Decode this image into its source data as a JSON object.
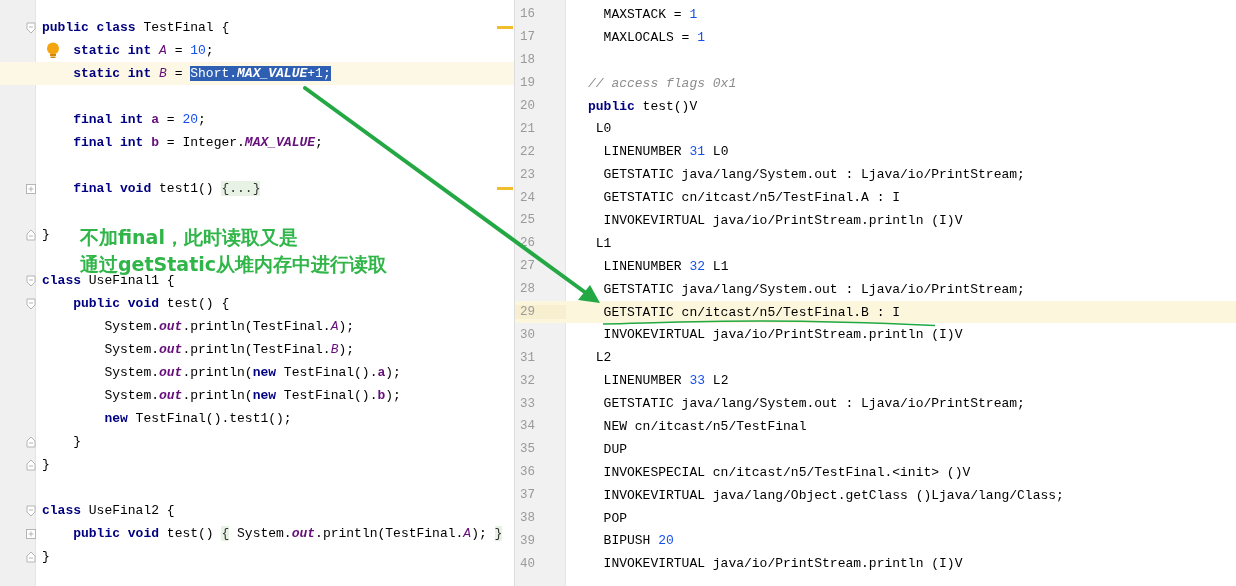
{
  "editor": {
    "lines": [
      {
        "kind": "fold-open",
        "current": false,
        "warning": true,
        "tokens": [
          {
            "text": "public class ",
            "kind": "kw"
          },
          {
            "text": "TestFinal {",
            "kind": "plain"
          }
        ],
        "children": [
          {
            "kind": "bulb",
            "current": false,
            "warning": false,
            "tokens": [
              {
                "text": "static int ",
                "kind": "kw"
              },
              {
                "text": "A",
                "kind": "static"
              },
              {
                "text": " = ",
                "kind": "plain"
              },
              {
                "text": "10",
                "kind": "num"
              },
              {
                "text": ";",
                "kind": "plain"
              }
            ]
          },
          {
            "kind": "plain",
            "current": true,
            "warning": false,
            "tokens": [
              {
                "text": "static int ",
                "kind": "kw"
              },
              {
                "text": "B",
                "kind": "static"
              },
              {
                "text": " = ",
                "kind": "plain"
              }
            ],
            "selection": [
              {
                "text": "Short.",
                "kind": "plain"
              },
              {
                "text": "MAX_VALUE",
                "kind": "const"
              },
              {
                "text": "+1;",
                "kind": "plain"
              }
            ]
          },
          {
            "kind": "blank",
            "current": false,
            "warning": false
          },
          {
            "kind": "plain",
            "current": false,
            "warning": false,
            "tokens": [
              {
                "text": "final int ",
                "kind": "kw"
              },
              {
                "text": "a",
                "kind": "field"
              },
              {
                "text": " = ",
                "kind": "plain"
              },
              {
                "text": "20",
                "kind": "num"
              },
              {
                "text": ";",
                "kind": "plain"
              }
            ]
          },
          {
            "kind": "plain",
            "current": false,
            "warning": false,
            "tokens": [
              {
                "text": "final int ",
                "kind": "kw"
              },
              {
                "text": "b",
                "kind": "field"
              },
              {
                "text": " = Integer.",
                "kind": "plain"
              },
              {
                "text": "MAX_VALUE",
                "kind": "const"
              },
              {
                "text": ";",
                "kind": "plain"
              }
            ]
          },
          {
            "kind": "blank",
            "current": false,
            "warning": false
          },
          {
            "kind": "fold-closed",
            "current": false,
            "warning": true,
            "tokens": [
              {
                "text": "final void ",
                "kind": "kw"
              },
              {
                "text": "test1() ",
                "kind": "plain"
              },
              {
                "text": "{...}",
                "kind": "folded"
              }
            ]
          },
          {
            "kind": "blank",
            "current": false,
            "warning": false
          }
        ]
      },
      {
        "kind": "fold-end",
        "current": false,
        "warning": false,
        "tokens": [
          {
            "text": "}",
            "kind": "plain"
          }
        ]
      },
      {
        "kind": "blank",
        "current": false,
        "warning": false
      },
      {
        "kind": "fold-open",
        "current": false,
        "warning": false,
        "tokens": [
          {
            "text": "class ",
            "kind": "kw"
          },
          {
            "text": "UseFinal1 {",
            "kind": "plain"
          }
        ],
        "children": [
          {
            "kind": "fold-open",
            "current": false,
            "warning": false,
            "tokens": [
              {
                "text": "public void ",
                "kind": "kw"
              },
              {
                "text": "test() {",
                "kind": "plain"
              }
            ],
            "children": [
              {
                "kind": "plain",
                "current": false,
                "warning": false,
                "tokens": [
                  {
                    "text": "System.",
                    "kind": "plain"
                  },
                  {
                    "text": "out",
                    "kind": "const"
                  },
                  {
                    "text": ".println(TestFinal.",
                    "kind": "plain"
                  },
                  {
                    "text": "A",
                    "kind": "static"
                  },
                  {
                    "text": ");",
                    "kind": "plain"
                  }
                ]
              },
              {
                "kind": "plain",
                "current": false,
                "warning": false,
                "tokens": [
                  {
                    "text": "System.",
                    "kind": "plain"
                  },
                  {
                    "text": "out",
                    "kind": "const"
                  },
                  {
                    "text": ".println(TestFinal.",
                    "kind": "plain"
                  },
                  {
                    "text": "B",
                    "kind": "static"
                  },
                  {
                    "text": ");",
                    "kind": "plain"
                  }
                ]
              },
              {
                "kind": "plain",
                "current": false,
                "warning": false,
                "tokens": [
                  {
                    "text": "System.",
                    "kind": "plain"
                  },
                  {
                    "text": "out",
                    "kind": "const"
                  },
                  {
                    "text": ".println(",
                    "kind": "plain"
                  },
                  {
                    "text": "new",
                    "kind": "kw"
                  },
                  {
                    "text": " TestFinal().",
                    "kind": "plain"
                  },
                  {
                    "text": "a",
                    "kind": "field"
                  },
                  {
                    "text": ");",
                    "kind": "plain"
                  }
                ]
              },
              {
                "kind": "plain",
                "current": false,
                "warning": false,
                "tokens": [
                  {
                    "text": "System.",
                    "kind": "plain"
                  },
                  {
                    "text": "out",
                    "kind": "const"
                  },
                  {
                    "text": ".println(",
                    "kind": "plain"
                  },
                  {
                    "text": "new",
                    "kind": "kw"
                  },
                  {
                    "text": " TestFinal().",
                    "kind": "plain"
                  },
                  {
                    "text": "b",
                    "kind": "field"
                  },
                  {
                    "text": ");",
                    "kind": "plain"
                  }
                ]
              },
              {
                "kind": "plain",
                "current": false,
                "warning": false,
                "tokens": [
                  {
                    "text": "new",
                    "kind": "kw"
                  },
                  {
                    "text": " TestFinal().test1();",
                    "kind": "plain"
                  }
                ]
              }
            ]
          },
          {
            "kind": "fold-end",
            "current": false,
            "warning": false,
            "tokens": [
              {
                "text": "}",
                "kind": "plain"
              }
            ]
          }
        ]
      },
      {
        "kind": "fold-end",
        "current": false,
        "warning": false,
        "tokens": [
          {
            "text": "}",
            "kind": "plain"
          }
        ]
      },
      {
        "kind": "blank",
        "current": false,
        "warning": false
      },
      {
        "kind": "fold-open",
        "current": false,
        "warning": false,
        "tokens": [
          {
            "text": "class ",
            "kind": "kw"
          },
          {
            "text": "UseFinal2 {",
            "kind": "plain"
          }
        ],
        "children": [
          {
            "kind": "fold-closed",
            "current": false,
            "warning": false,
            "tokens": [
              {
                "text": "public void ",
                "kind": "kw"
              },
              {
                "text": "test() ",
                "kind": "plain"
              },
              {
                "text": "{",
                "kind": "folded"
              },
              {
                "text": " System.",
                "kind": "plain"
              },
              {
                "text": "out",
                "kind": "const"
              },
              {
                "text": ".println(TestFinal.",
                "kind": "plain"
              },
              {
                "text": "A",
                "kind": "static"
              },
              {
                "text": "); ",
                "kind": "plain"
              },
              {
                "text": "}",
                "kind": "folded"
              }
            ]
          }
        ]
      },
      {
        "kind": "fold-end",
        "current": false,
        "warning": false,
        "tokens": [
          {
            "text": "}",
            "kind": "plain"
          }
        ]
      }
    ]
  },
  "bytecode": {
    "lines": [
      {
        "number": "16",
        "kind": "instruction",
        "current": false,
        "tokens": [
          {
            "text": "MAXSTACK = ",
            "kind": "plain"
          },
          {
            "text": "1",
            "kind": "num"
          }
        ]
      },
      {
        "number": "17",
        "kind": "instruction",
        "current": false,
        "tokens": [
          {
            "text": "MAXLOCALS = ",
            "kind": "plain"
          },
          {
            "text": "1",
            "kind": "num"
          }
        ]
      },
      {
        "number": "18",
        "kind": "blank",
        "current": false
      },
      {
        "number": "19",
        "kind": "header",
        "current": false,
        "tokens": [
          {
            "text": "// access flags 0x1",
            "kind": "comment"
          }
        ]
      },
      {
        "number": "20",
        "kind": "header",
        "current": false,
        "tokens": [
          {
            "text": "public",
            "kind": "kw"
          },
          {
            "text": " test()V",
            "kind": "plain"
          }
        ]
      },
      {
        "number": "21",
        "kind": "label",
        "current": false,
        "tokens": [
          {
            "text": "L0",
            "kind": "plain"
          }
        ]
      },
      {
        "number": "22",
        "kind": "instruction",
        "current": false,
        "tokens": [
          {
            "text": "LINENUMBER ",
            "kind": "plain"
          },
          {
            "text": "31",
            "kind": "num"
          },
          {
            "text": " L0",
            "kind": "plain"
          }
        ]
      },
      {
        "number": "23",
        "kind": "instruction",
        "current": false,
        "tokens": [
          {
            "text": "GETSTATIC java/lang/System.out : Ljava/io/PrintStream;",
            "kind": "plain"
          }
        ]
      },
      {
        "number": "24",
        "kind": "instruction",
        "current": false,
        "tokens": [
          {
            "text": "GETSTATIC cn/itcast/n5/TestFinal.A : I",
            "kind": "plain"
          }
        ]
      },
      {
        "number": "25",
        "kind": "instruction",
        "current": false,
        "tokens": [
          {
            "text": "INVOKEVIRTUAL java/io/PrintStream.println (I)V",
            "kind": "plain"
          }
        ]
      },
      {
        "number": "26",
        "kind": "label",
        "current": false,
        "tokens": [
          {
            "text": "L1",
            "kind": "plain"
          }
        ]
      },
      {
        "number": "27",
        "kind": "instruction",
        "current": false,
        "tokens": [
          {
            "text": "LINENUMBER ",
            "kind": "plain"
          },
          {
            "text": "32",
            "kind": "num"
          },
          {
            "text": " L1",
            "kind": "plain"
          }
        ]
      },
      {
        "number": "28",
        "kind": "instruction",
        "current": false,
        "tokens": [
          {
            "text": "GETSTATIC java/lang/System.out : Ljava/io/PrintStream;",
            "kind": "plain"
          }
        ]
      },
      {
        "number": "29",
        "kind": "instruction",
        "current": true,
        "tokens": [
          {
            "text": "GETSTATIC cn/itcast/n5/TestFinal.B : I",
            "kind": "plain"
          }
        ]
      },
      {
        "number": "30",
        "kind": "instruction",
        "current": false,
        "tokens": [
          {
            "text": "INVOKEVIRTUAL java/io/PrintStream.println (I)V",
            "kind": "plain"
          }
        ]
      },
      {
        "number": "31",
        "kind": "label",
        "current": false,
        "tokens": [
          {
            "text": "L2",
            "kind": "plain"
          }
        ]
      },
      {
        "number": "32",
        "kind": "instruction",
        "current": false,
        "tokens": [
          {
            "text": "LINENUMBER ",
            "kind": "plain"
          },
          {
            "text": "33",
            "kind": "num"
          },
          {
            "text": " L2",
            "kind": "plain"
          }
        ]
      },
      {
        "number": "33",
        "kind": "instruction",
        "current": false,
        "tokens": [
          {
            "text": "GETSTATIC java/lang/System.out : Ljava/io/PrintStream;",
            "kind": "plain"
          }
        ]
      },
      {
        "number": "34",
        "kind": "instruction",
        "current": false,
        "tokens": [
          {
            "text": "NEW cn/itcast/n5/TestFinal",
            "kind": "plain"
          }
        ]
      },
      {
        "number": "35",
        "kind": "instruction",
        "current": false,
        "tokens": [
          {
            "text": "DUP",
            "kind": "plain"
          }
        ]
      },
      {
        "number": "36",
        "kind": "instruction",
        "current": false,
        "tokens": [
          {
            "text": "INVOKESPECIAL cn/itcast/n5/TestFinal.<init> ()V",
            "kind": "plain"
          }
        ]
      },
      {
        "number": "37",
        "kind": "instruction",
        "current": false,
        "tokens": [
          {
            "text": "INVOKEVIRTUAL java/lang/Object.getClass ()Ljava/lang/Class;",
            "kind": "plain"
          }
        ]
      },
      {
        "number": "38",
        "kind": "instruction",
        "current": false,
        "tokens": [
          {
            "text": "POP",
            "kind": "plain"
          }
        ]
      },
      {
        "number": "39",
        "kind": "instruction",
        "current": false,
        "tokens": [
          {
            "text": "BIPUSH ",
            "kind": "plain"
          },
          {
            "text": "20",
            "kind": "num"
          }
        ]
      },
      {
        "number": "40",
        "kind": "instruction",
        "current": false,
        "tokens": [
          {
            "text": "INVOKEVIRTUAL java/io/PrintStream.println (I)V",
            "kind": "plain"
          }
        ]
      }
    ]
  },
  "annotation": {
    "lines": [
      "不加final，此时读取又是",
      "通过getStatic从堆内存中进行读取"
    ]
  }
}
